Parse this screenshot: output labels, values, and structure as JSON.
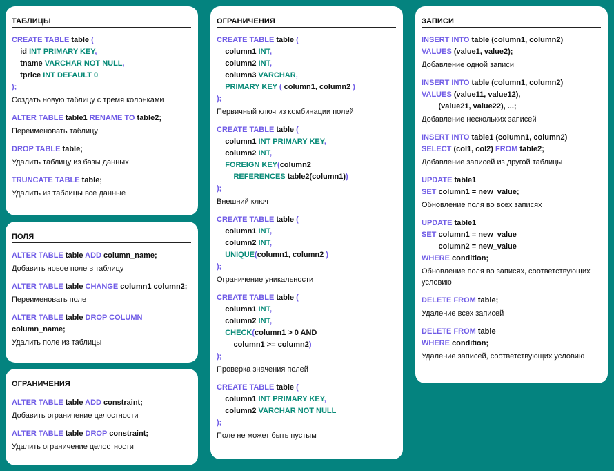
{
  "colors": {
    "background": "#04837f",
    "keyword": "#6f5be6",
    "type": "#078a77"
  },
  "cards": [
    {
      "title": "ТАБЛИЦЫ",
      "entries": [
        {
          "code": [
            [
              [
                "k",
                "CREATE TABLE"
              ],
              [
                "p",
                " table "
              ],
              [
                "k",
                "("
              ]
            ],
            [
              [
                "p",
                "    id "
              ],
              [
                "t",
                "INT PRIMARY KEY"
              ],
              [
                "k",
                ","
              ]
            ],
            [
              [
                "p",
                "    tname "
              ],
              [
                "t",
                "VARCHAR NOT NULL"
              ],
              [
                "k",
                ","
              ]
            ],
            [
              [
                "p",
                "    tprice "
              ],
              [
                "t",
                "INT DEFAULT 0"
              ]
            ],
            [
              [
                "k",
                ");"
              ]
            ]
          ],
          "desc": "Создать новую таблицу с тремя колонками"
        },
        {
          "code": [
            [
              [
                "k",
                "ALTER TABLE"
              ],
              [
                "p",
                " table1 "
              ],
              [
                "k",
                "RENAME TO"
              ],
              [
                "p",
                " table2;"
              ]
            ]
          ],
          "desc": "Переименовать таблицу"
        },
        {
          "code": [
            [
              [
                "k",
                "DROP TABLE"
              ],
              [
                "p",
                " table;"
              ]
            ]
          ],
          "desc": "Удалить таблицу из базы данных"
        },
        {
          "code": [
            [
              [
                "k",
                "TRUNCATE TABLE"
              ],
              [
                "p",
                " table;"
              ]
            ]
          ],
          "desc": "Удалить из таблицы все данные"
        }
      ]
    },
    {
      "title": "ПОЛЯ",
      "entries": [
        {
          "code": [
            [
              [
                "k",
                "ALTER TABLE"
              ],
              [
                "p",
                " table "
              ],
              [
                "k",
                "ADD"
              ],
              [
                "p",
                " column_name;"
              ]
            ]
          ],
          "desc": "Добавить новое поле в таблицу"
        },
        {
          "code": [
            [
              [
                "k",
                "ALTER TABLE"
              ],
              [
                "p",
                " table "
              ],
              [
                "k",
                "CHANGE"
              ],
              [
                "p",
                " column1 column2;"
              ]
            ]
          ],
          "desc": "Переименовать поле"
        },
        {
          "code": [
            [
              [
                "k",
                "ALTER TABLE"
              ],
              [
                "p",
                " table "
              ],
              [
                "k",
                "DROP COLUMN"
              ]
            ],
            [
              [
                "p",
                "column_name;"
              ]
            ]
          ],
          "desc": "Удалить поле из таблицы"
        }
      ]
    },
    {
      "title": "ОГРАНИЧЕНИЯ",
      "entries": [
        {
          "code": [
            [
              [
                "k",
                "ALTER TABLE"
              ],
              [
                "p",
                " table "
              ],
              [
                "k",
                "ADD"
              ],
              [
                "p",
                " constraint;"
              ]
            ]
          ],
          "desc": "Добавить ограничение целостности"
        },
        {
          "code": [
            [
              [
                "k",
                "ALTER TABLE"
              ],
              [
                "p",
                " table "
              ],
              [
                "k",
                "DROP"
              ],
              [
                "p",
                " constraint;"
              ]
            ]
          ],
          "desc": "Удалить ограничение целостности"
        }
      ]
    },
    {
      "title": "ОГРАНИЧЕНИЯ",
      "entries": [
        {
          "code": [
            [
              [
                "k",
                "CREATE TABLE"
              ],
              [
                "p",
                " table "
              ],
              [
                "k",
                "("
              ]
            ],
            [
              [
                "p",
                "    column1 "
              ],
              [
                "t",
                "INT"
              ],
              [
                "k",
                ","
              ]
            ],
            [
              [
                "p",
                "    column2 "
              ],
              [
                "t",
                "INT"
              ],
              [
                "k",
                ","
              ]
            ],
            [
              [
                "p",
                "    column3 "
              ],
              [
                "t",
                "VARCHAR"
              ],
              [
                "k",
                ","
              ]
            ],
            [
              [
                "t",
                "    PRIMARY KEY"
              ],
              [
                "k",
                " ("
              ],
              [
                "p",
                " column1, column2 "
              ],
              [
                "k",
                ")"
              ]
            ],
            [
              [
                "k",
                ");"
              ]
            ]
          ],
          "desc": "Первичный ключ из комбинации полей"
        },
        {
          "code": [
            [
              [
                "k",
                "CREATE TABLE"
              ],
              [
                "p",
                " table "
              ],
              [
                "k",
                "("
              ]
            ],
            [
              [
                "p",
                "    column1 "
              ],
              [
                "t",
                "INT PRIMARY KEY"
              ],
              [
                "k",
                ","
              ]
            ],
            [
              [
                "p",
                "    column2 "
              ],
              [
                "t",
                "INT"
              ],
              [
                "k",
                ","
              ]
            ],
            [
              [
                "t",
                "    FOREIGN KEY"
              ],
              [
                "k",
                "("
              ],
              [
                "p",
                "column2"
              ]
            ],
            [
              [
                "t",
                "        REFERENCES"
              ],
              [
                "p",
                " table2(column1)"
              ],
              [
                "k",
                ")"
              ]
            ],
            [
              [
                "k",
                ");"
              ]
            ]
          ],
          "desc": "Внешний ключ"
        },
        {
          "code": [
            [
              [
                "k",
                "CREATE TABLE"
              ],
              [
                "p",
                " table "
              ],
              [
                "k",
                "("
              ]
            ],
            [
              [
                "p",
                "    column1 "
              ],
              [
                "t",
                "INT"
              ],
              [
                "k",
                ","
              ]
            ],
            [
              [
                "p",
                "    column2 "
              ],
              [
                "t",
                "INT"
              ],
              [
                "k",
                ","
              ]
            ],
            [
              [
                "t",
                "    UNIQUE"
              ],
              [
                "k",
                "("
              ],
              [
                "p",
                "column1, column2 "
              ],
              [
                "k",
                ")"
              ]
            ],
            [
              [
                "k",
                ");"
              ]
            ]
          ],
          "desc": "Ограничение уникальности"
        },
        {
          "code": [
            [
              [
                "k",
                "CREATE TABLE"
              ],
              [
                "p",
                " table "
              ],
              [
                "k",
                "("
              ]
            ],
            [
              [
                "p",
                "    column1 "
              ],
              [
                "t",
                "INT"
              ],
              [
                "k",
                ","
              ]
            ],
            [
              [
                "p",
                "    column2 "
              ],
              [
                "t",
                "INT"
              ],
              [
                "k",
                ","
              ]
            ],
            [
              [
                "t",
                "    CHECK"
              ],
              [
                "k",
                "("
              ],
              [
                "p",
                "column1 > 0 AND"
              ]
            ],
            [
              [
                "p",
                "        column1 >= column2"
              ],
              [
                "k",
                ")"
              ]
            ],
            [
              [
                "k",
                ");"
              ]
            ]
          ],
          "desc": "Проверка значения полей"
        },
        {
          "code": [
            [
              [
                "k",
                "CREATE TABLE"
              ],
              [
                "p",
                " table "
              ],
              [
                "k",
                "("
              ]
            ],
            [
              [
                "p",
                "    column1 "
              ],
              [
                "t",
                "INT PRIMARY KEY"
              ],
              [
                "k",
                ","
              ]
            ],
            [
              [
                "p",
                "    column2 "
              ],
              [
                "t",
                "VARCHAR NOT NULL"
              ]
            ],
            [
              [
                "k",
                ");"
              ]
            ]
          ],
          "desc": "Поле не может быть пустым"
        }
      ]
    },
    {
      "title": "ЗАПИСИ",
      "entries": [
        {
          "code": [
            [
              [
                "k",
                "INSERT INTO"
              ],
              [
                "p",
                " table (column1, column2)"
              ]
            ],
            [
              [
                "k",
                "VALUES"
              ],
              [
                "p",
                " (value1, value2);"
              ]
            ]
          ],
          "desc": "Добавление одной записи"
        },
        {
          "code": [
            [
              [
                "k",
                "INSERT INTO"
              ],
              [
                "p",
                " table (column1, column2)"
              ]
            ],
            [
              [
                "k",
                "VALUES"
              ],
              [
                "p",
                " (value11, value12),"
              ]
            ],
            [
              [
                "p",
                "        (value21, value22), ...;"
              ]
            ]
          ],
          "desc": "Добавление нескольких записей"
        },
        {
          "code": [
            [
              [
                "k",
                "INSERT INTO"
              ],
              [
                "p",
                " table1 (column1, column2)"
              ]
            ],
            [
              [
                "k",
                "SELECT"
              ],
              [
                "p",
                " (col1, col2) "
              ],
              [
                "k",
                "FROM"
              ],
              [
                "p",
                " table2;"
              ]
            ]
          ],
          "desc": "Добавление записей из другой таблицы"
        },
        {
          "code": [
            [
              [
                "k",
                "UPDATE"
              ],
              [
                "p",
                " table1"
              ]
            ],
            [
              [
                "k",
                "SET"
              ],
              [
                "p",
                " column1 = new_value;"
              ]
            ]
          ],
          "desc": "Обновление поля во всех записях"
        },
        {
          "code": [
            [
              [
                "k",
                "UPDATE"
              ],
              [
                "p",
                " table1"
              ]
            ],
            [
              [
                "k",
                "SET"
              ],
              [
                "p",
                " column1 = new_value"
              ]
            ],
            [
              [
                "p",
                "        column2 = new_value"
              ]
            ],
            [
              [
                "k",
                "WHERE"
              ],
              [
                "p",
                " condition;"
              ]
            ]
          ],
          "desc": "Обновление поля во записях, соответствующих условию"
        },
        {
          "code": [
            [
              [
                "k",
                "DELETE FROM"
              ],
              [
                "p",
                " table;"
              ]
            ]
          ],
          "desc": "Удаление всех записей"
        },
        {
          "code": [
            [
              [
                "k",
                "DELETE FROM"
              ],
              [
                "p",
                " table"
              ]
            ],
            [
              [
                "k",
                "WHERE"
              ],
              [
                "p",
                " condition;"
              ]
            ]
          ],
          "desc": "Удаление записей, соответствующих условию"
        }
      ]
    }
  ]
}
